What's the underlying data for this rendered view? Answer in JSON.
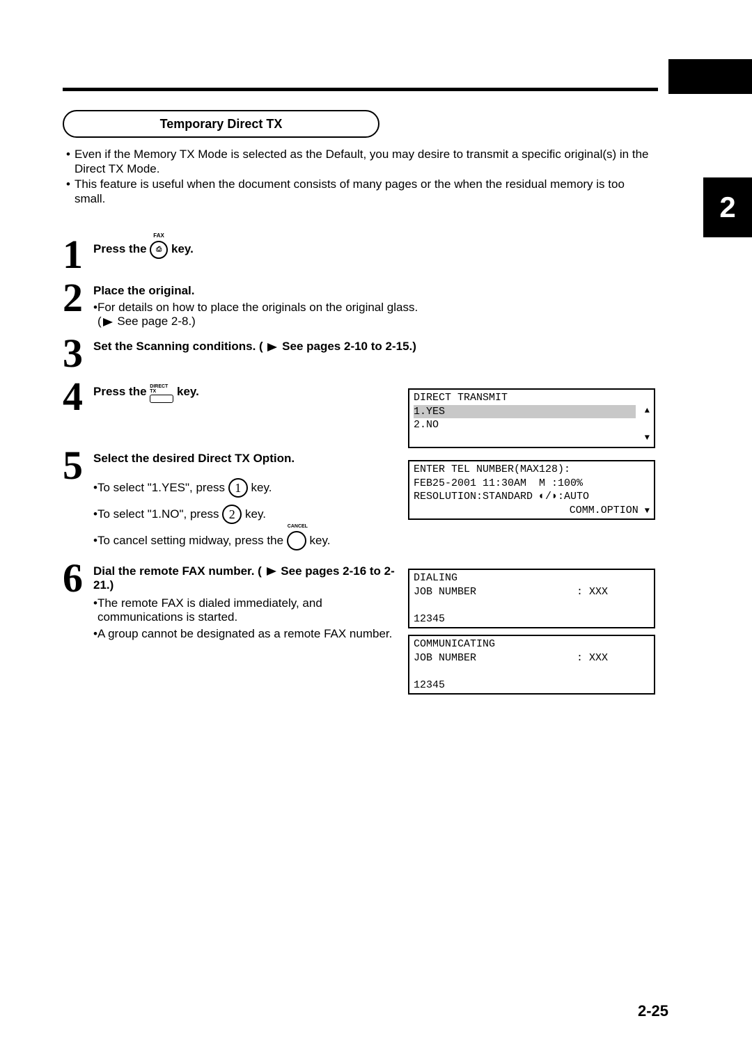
{
  "chapter_tab": "2",
  "section_title": "Temporary Direct TX",
  "intro": {
    "bullet1": "Even if the Memory TX Mode is selected as the Default, you may desire to transmit a specific original(s) in the Direct TX Mode.",
    "bullet2": "This feature is useful when the document consists of many pages or the when the residual memory is too small."
  },
  "steps": {
    "s1": {
      "num": "1",
      "pre": "Press the",
      "post": "key.",
      "fax_label": "FAX",
      "fax_icon": "⎙"
    },
    "s2": {
      "num": "2",
      "title": "Place the original.",
      "sub_pre": "For details on how to place the originals on the original glass.",
      "sub_xref": "See page 2-8.)"
    },
    "s3": {
      "num": "3",
      "pre": "Set the Scanning conditions. (",
      "post": "See pages 2-10 to 2-15.)"
    },
    "s4": {
      "num": "4",
      "pre": "Press the",
      "post": "key.",
      "btn_l1": "DIRECT",
      "btn_l2": "TX"
    },
    "s5": {
      "num": "5",
      "title": "Select the desired Direct TX Option.",
      "line1_pre": "To select \"1.YES\", press",
      "line1_post": "key.",
      "key1": "1",
      "line2_pre": "To select \"1.NO\", press",
      "line2_post": "key.",
      "key2": "2",
      "line3_pre": "To cancel setting midway, press the",
      "line3_post": "key.",
      "cancel_label": "CANCEL"
    },
    "s6": {
      "num": "6",
      "pre": "Dial the remote FAX number. (",
      "post": "See pages 2-16 to 2-21.)",
      "sub1": "The remote FAX is dialed immediately, and communications is started.",
      "sub2": "A group cannot be designated as a remote FAX number."
    }
  },
  "lcd1": {
    "l1": "DIRECT TRANSMIT",
    "l2": "1.YES",
    "l3": "2.NO",
    "up": "▲",
    "down": "▼"
  },
  "lcd2": {
    "l1": "ENTER TEL NUMBER(MAX128):",
    "l2": "FEB25-2001 11:30AM  M :100%",
    "l3": "RESOLUTION:STANDARD ◐/◗:AUTO",
    "l4": "COMM.OPTION",
    "down": "▼"
  },
  "lcd3": {
    "l1": "DIALING",
    "l2a": "JOB NUMBER",
    "l2b": ": XXX",
    "l3": "",
    "l4": "12345"
  },
  "lcd4": {
    "l1": "COMMUNICATING",
    "l2a": "JOB NUMBER",
    "l2b": ": XXX",
    "l3": "",
    "l4": "12345"
  },
  "page_number": "2-25"
}
